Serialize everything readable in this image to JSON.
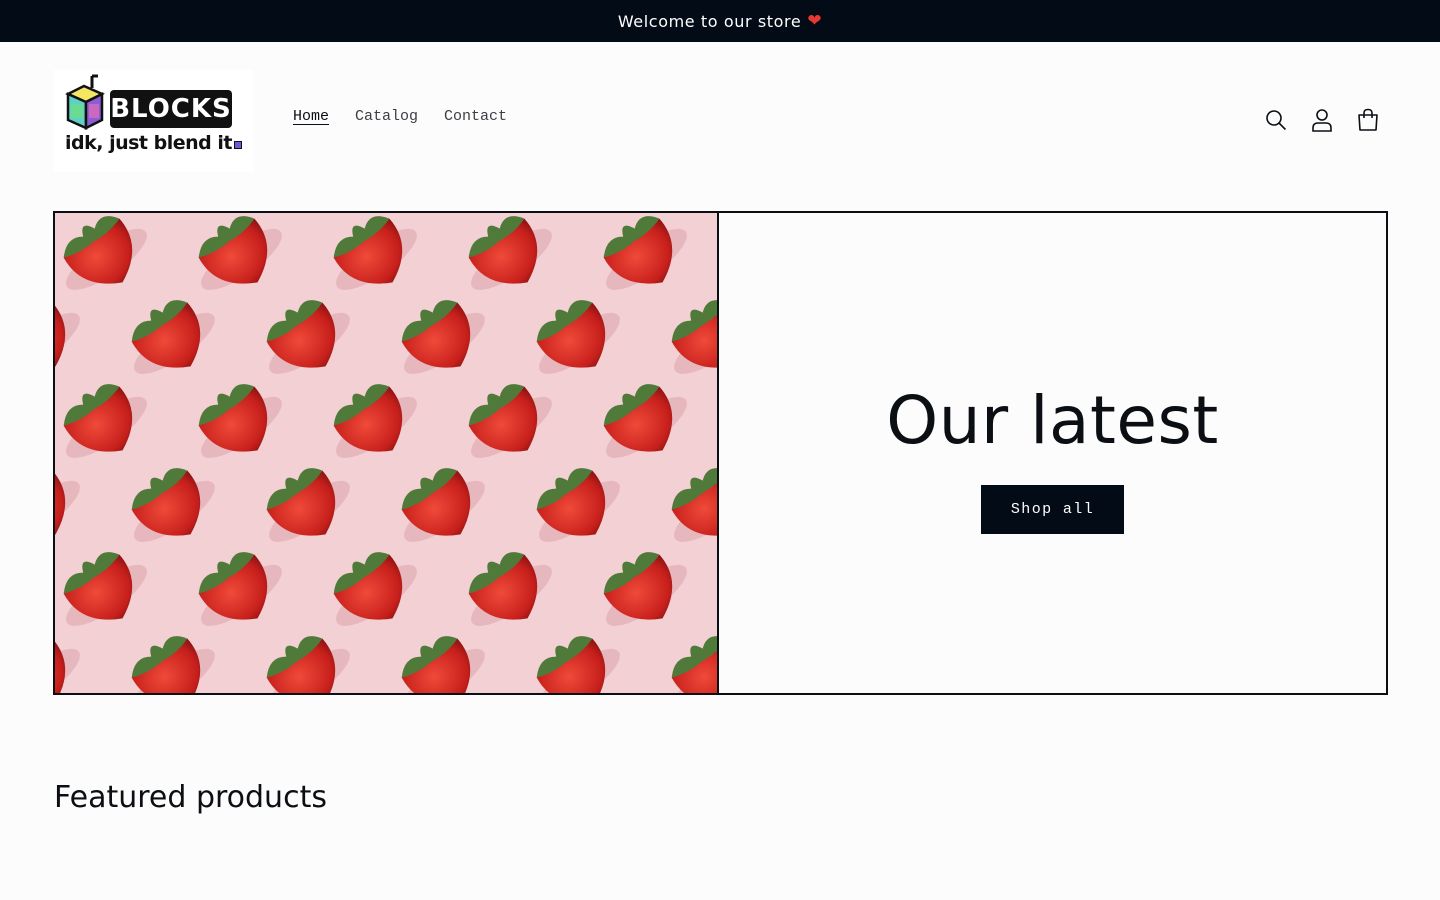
{
  "announcement": {
    "text": "Welcome to our store",
    "icon": "heart-icon"
  },
  "header": {
    "logo": {
      "wordmark": "BLOCKS",
      "tagline": "idk, just blend it"
    },
    "nav": [
      {
        "label": "Home",
        "active": true
      },
      {
        "label": "Catalog",
        "active": false
      },
      {
        "label": "Contact",
        "active": false
      }
    ],
    "icons": [
      "search-icon",
      "account-icon",
      "cart-icon"
    ]
  },
  "hero": {
    "image": "strawberries-on-pink",
    "title": "Our latest",
    "button_label": "Shop all"
  },
  "featured": {
    "title": "Featured products"
  },
  "colors": {
    "dark": "#030b16",
    "background": "#fcfcfc",
    "heart": "#e53935",
    "hero_image_bg": "#f2d0d4"
  }
}
